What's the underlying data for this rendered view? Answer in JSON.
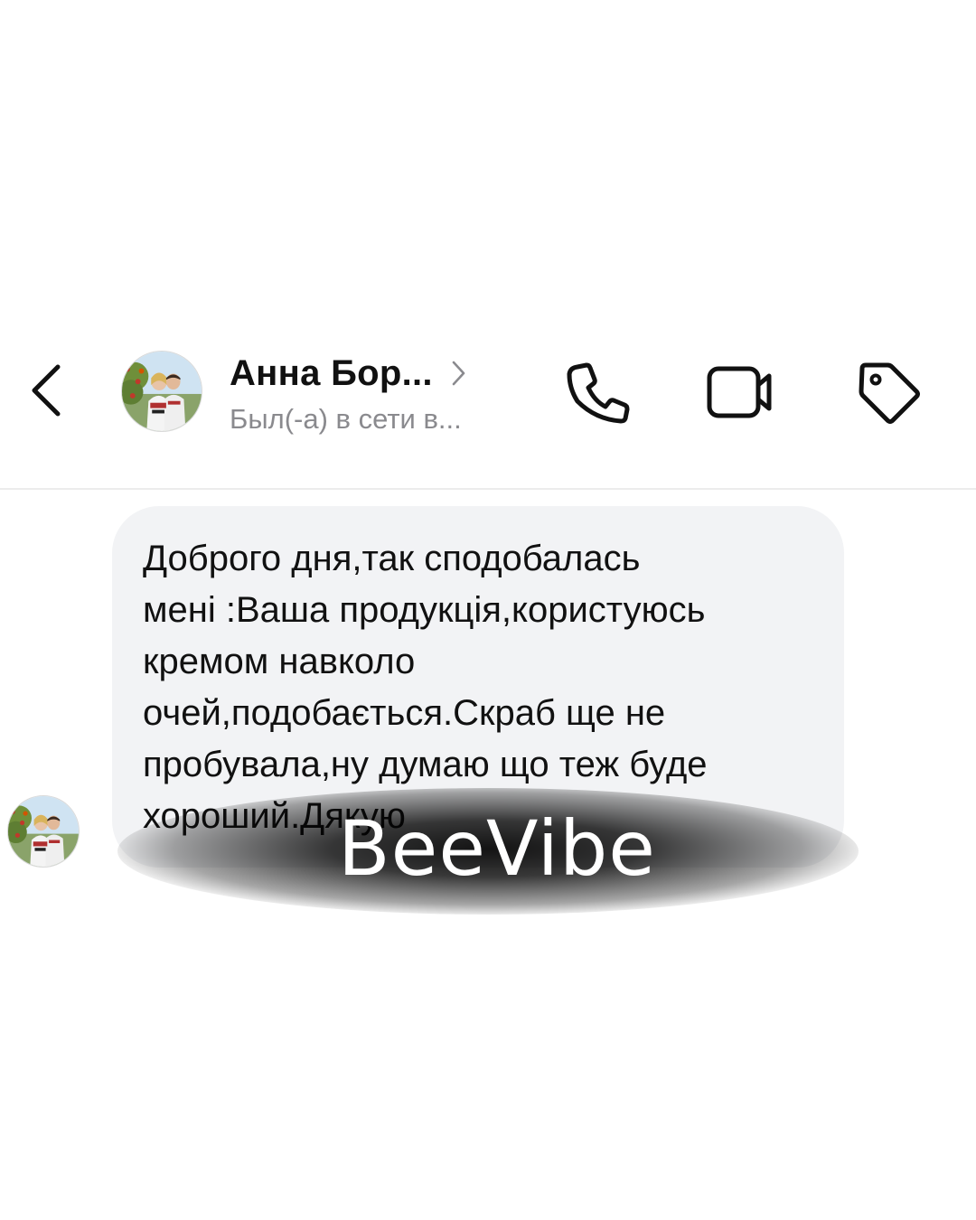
{
  "header": {
    "contact_name": "Анна Бор...",
    "contact_status": "Был(-а) в сети в..."
  },
  "icons": {
    "back": "chevron-left-icon",
    "profile": "chevron-right-icon",
    "call": "phone-icon",
    "video": "video-camera-icon",
    "tag": "tag-icon"
  },
  "messages": [
    {
      "text": "Доброго дня,так сподобалась\nмені :Ваша продукція,користуюсь\nкремом навколо\nочей,подобається.Скраб ще не\nпробувала,ну думаю що теж буде\nхороший.Дякую"
    }
  ],
  "watermark": {
    "text": "BeeVibe"
  },
  "colors": {
    "background": "#ffffff",
    "bubble": "#f2f3f5",
    "text": "#111111",
    "status": "#8a8a8e"
  }
}
